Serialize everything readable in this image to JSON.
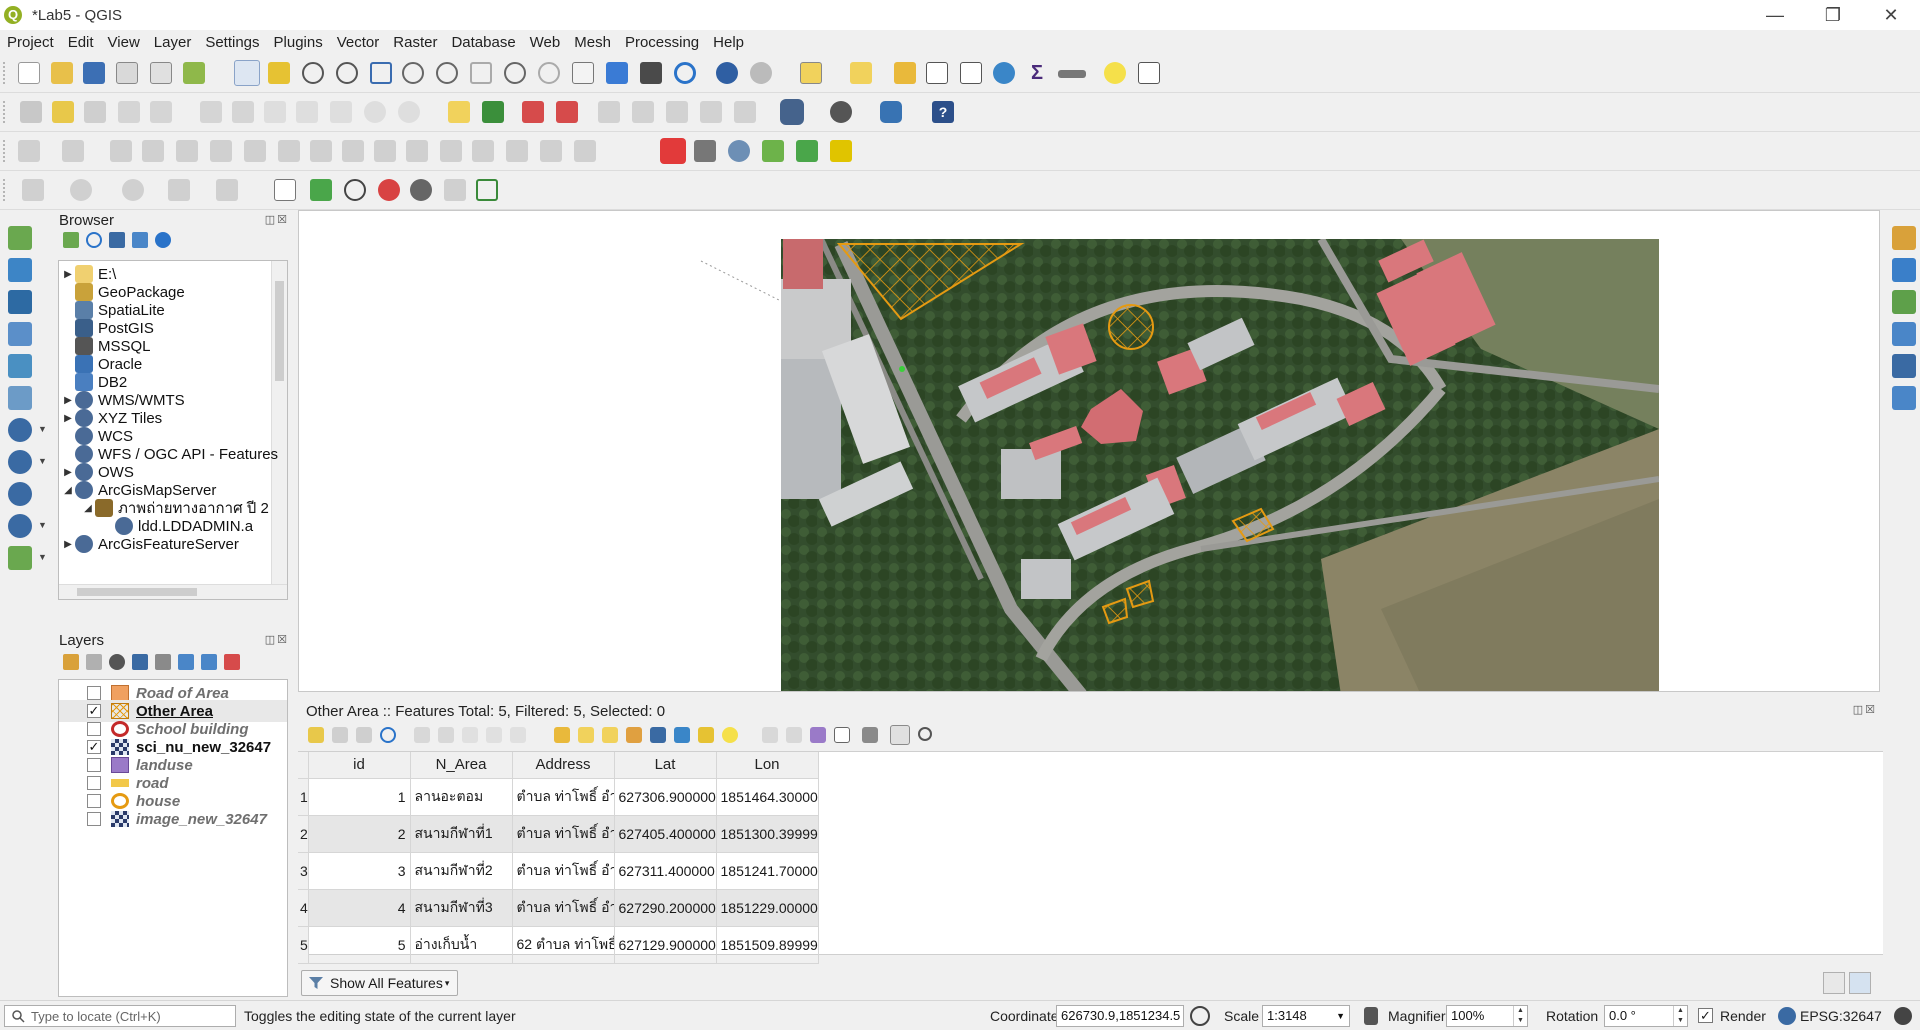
{
  "window": {
    "title": "*Lab5 - QGIS",
    "logo_letter": "Q",
    "controls": [
      "—",
      "❐",
      "✕"
    ]
  },
  "menubar": [
    "Project",
    "Edit",
    "View",
    "Layer",
    "Settings",
    "Plugins",
    "Vector",
    "Raster",
    "Database",
    "Web",
    "Mesh",
    "Processing",
    "Help"
  ],
  "browser": {
    "title": "Browser",
    "controls": "◫☒",
    "items": [
      {
        "label": "E:\\",
        "icon": "folder-icon",
        "arrow": "▶",
        "level": 0
      },
      {
        "label": "GeoPackage",
        "icon": "geopackage-icon",
        "arrow": "",
        "level": 0
      },
      {
        "label": "SpatiaLite",
        "icon": "spatialite-icon",
        "arrow": "",
        "level": 0
      },
      {
        "label": "PostGIS",
        "icon": "postgis-icon",
        "arrow": "",
        "level": 0
      },
      {
        "label": "MSSQL",
        "icon": "mssql-icon",
        "arrow": "",
        "level": 0
      },
      {
        "label": "Oracle",
        "icon": "oracle-icon",
        "arrow": "",
        "level": 0
      },
      {
        "label": "DB2",
        "icon": "db2-icon",
        "arrow": "",
        "level": 0
      },
      {
        "label": "WMS/WMTS",
        "icon": "globe-icon",
        "arrow": "▶",
        "level": 0
      },
      {
        "label": "XYZ Tiles",
        "icon": "globe-icon",
        "arrow": "▶",
        "level": 0
      },
      {
        "label": "WCS",
        "icon": "globe-icon",
        "arrow": "",
        "level": 0
      },
      {
        "label": "WFS / OGC API - Features",
        "icon": "globe-icon",
        "arrow": "",
        "level": 0
      },
      {
        "label": "OWS",
        "icon": "globe-icon",
        "arrow": "▶",
        "level": 0
      },
      {
        "label": "ArcGisMapServer",
        "icon": "globe-icon",
        "arrow": "◢",
        "level": 0
      },
      {
        "label": "ภาพถ่ายทางอากาศ ปี 2",
        "icon": "connection-icon",
        "arrow": "◢",
        "level": 1
      },
      {
        "label": "ldd.LDDADMIN.a",
        "icon": "globe-icon",
        "arrow": "",
        "level": 2
      },
      {
        "label": "ArcGisFeatureServer",
        "icon": "globe-icon",
        "arrow": "▶",
        "level": 0
      }
    ]
  },
  "layers": {
    "title": "Layers",
    "controls": "◫☒",
    "items": [
      {
        "name": "Road of Area",
        "checked": false,
        "active": false,
        "symbol": "fill-orange"
      },
      {
        "name": "Other Area",
        "checked": true,
        "active": true,
        "symbol": "hatch-orange"
      },
      {
        "name": "School building",
        "checked": false,
        "active": false,
        "symbol": "point-red"
      },
      {
        "name": "sci_nu_new_32647",
        "checked": true,
        "active": false,
        "symbol": "raster"
      },
      {
        "name": "landuse",
        "checked": false,
        "active": false,
        "symbol": "fill-purple"
      },
      {
        "name": "road",
        "checked": false,
        "active": false,
        "symbol": "line-yellow"
      },
      {
        "name": "house",
        "checked": false,
        "active": false,
        "symbol": "point-orange"
      },
      {
        "name": "image_new_32647",
        "checked": false,
        "active": false,
        "symbol": "raster"
      }
    ],
    "check_mark": "✓"
  },
  "attribute_table": {
    "title": "Other Area :: Features Total: 5, Filtered: 5, Selected: 0",
    "controls": "◫☒",
    "columns": [
      "id",
      "N_Area",
      "Address",
      "Lat",
      "Lon"
    ],
    "rows": [
      [
        "1",
        "1",
        "ลานอะตอม",
        "ตำบล ท่าโพธิ์ อำ...",
        "627306.900000...",
        "1851464.30000..."
      ],
      [
        "2",
        "2",
        "สนามกีฬาที่1",
        "ตำบล ท่าโพธิ์ อำ...",
        "627405.400000...",
        "1851300.39999..."
      ],
      [
        "3",
        "3",
        "สนามกีฬาที่2",
        "ตำบล ท่าโพธิ์ อำ...",
        "627311.400000...",
        "1851241.70000..."
      ],
      [
        "4",
        "4",
        "สนามกีฬาที่3",
        "ตำบล ท่าโพธิ์ อำ...",
        "627290.200000...",
        "1851229.00000..."
      ],
      [
        "5",
        "5",
        "อ่างเก็บน้ำ",
        "62 ตำบล ท่าโพธิ์ ...",
        "627129.900000...",
        "1851509.89999..."
      ]
    ],
    "show_all_label": "Show All Features"
  },
  "statusbar": {
    "locate_placeholder": "Type to locate (Ctrl+K)",
    "message": "Toggles the editing state of the current layer",
    "coordinate_label": "Coordinate",
    "coordinate_value": "626730.9,1851234.5",
    "scale_label": "Scale",
    "scale_value": "1:3148",
    "magnifier_label": "Magnifier",
    "magnifier_value": "100%",
    "rotation_label": "Rotation",
    "rotation_value": "0.0 °",
    "render_label": "Render",
    "crs": "EPSG:32647"
  },
  "colors": {
    "accent_green": "#93b023",
    "hatch_orange": "#e59a12",
    "selection_blue": "#2a6db8"
  }
}
